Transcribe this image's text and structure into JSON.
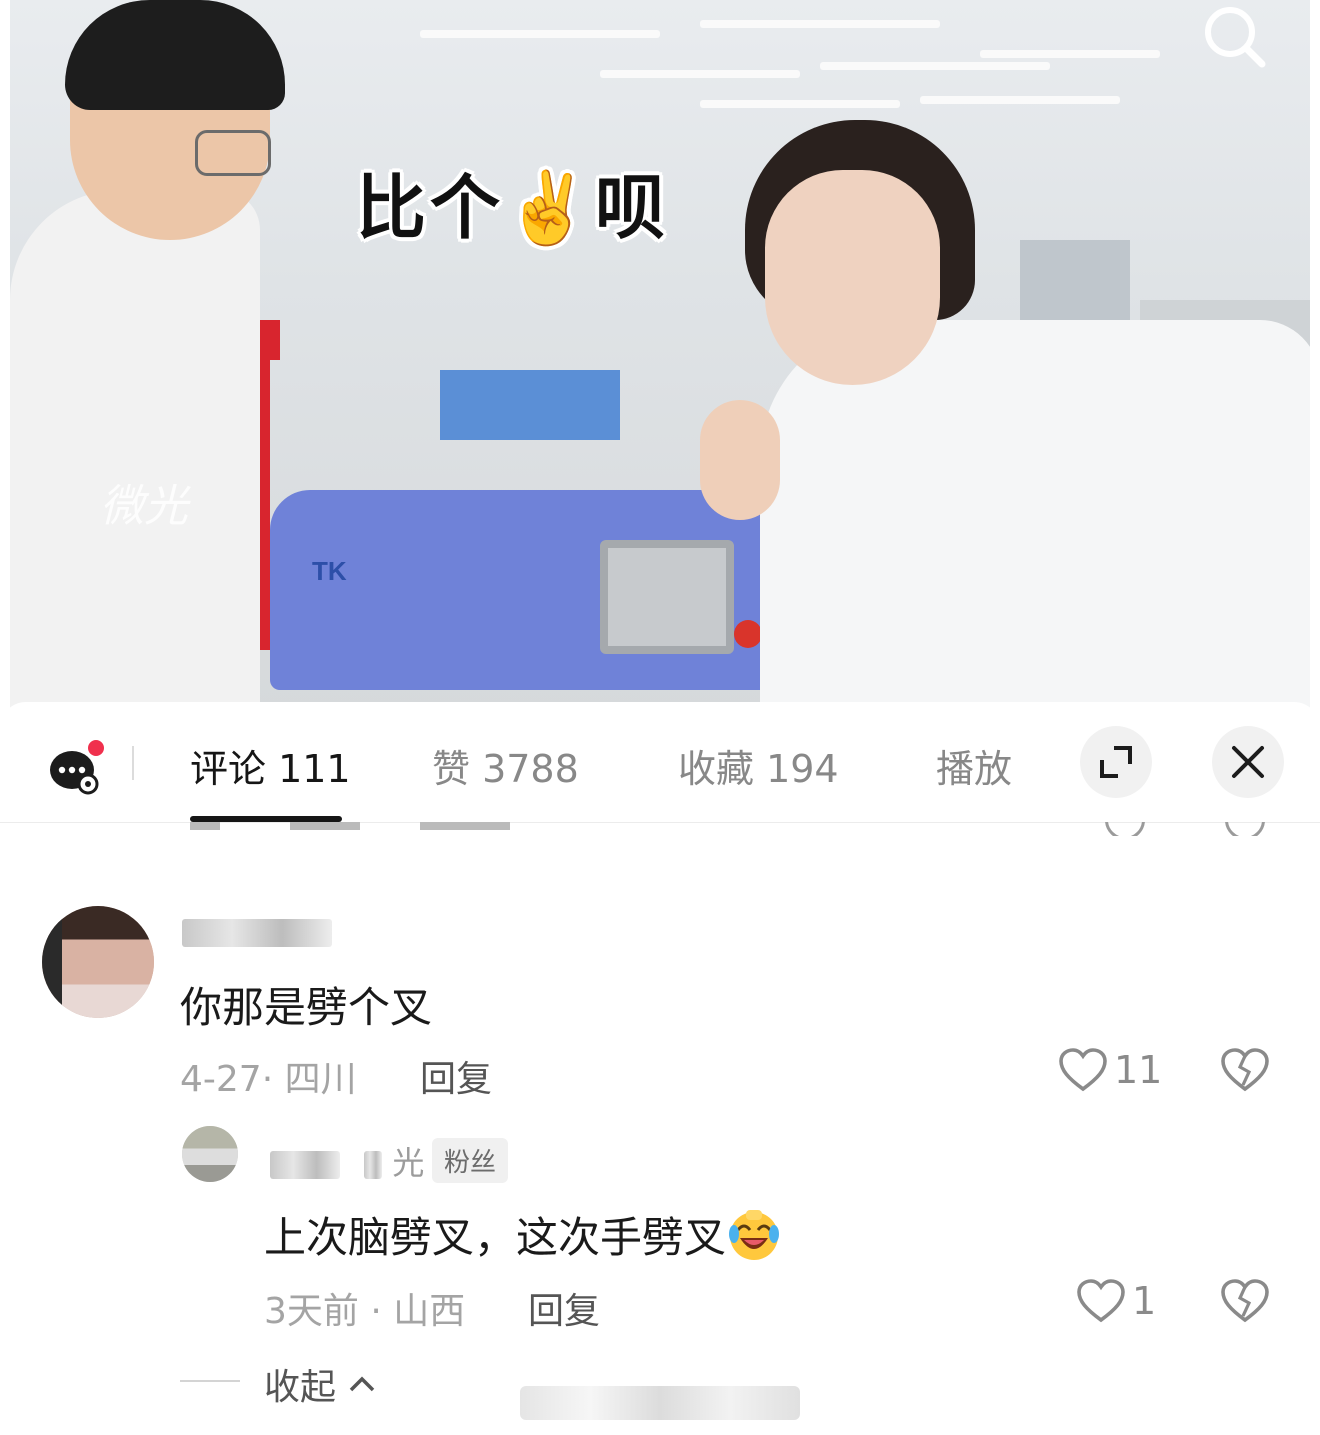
{
  "video": {
    "overlay_caption": "比个✌️呗",
    "watermark": "微光"
  },
  "tabs": [
    {
      "label": "评论 111",
      "active": true
    },
    {
      "label": "赞 3788",
      "active": false
    },
    {
      "label": "收藏 194",
      "active": false
    },
    {
      "label": "播放",
      "active": false
    }
  ],
  "icons": {
    "chat": "chat-bubble-icon",
    "search": "search-icon",
    "expand": "expand-icon",
    "close": "close-icon",
    "like": "heart-icon",
    "dislike": "broken-heart-icon"
  },
  "comments": [
    {
      "text": "你那是劈个叉",
      "date": "4-27",
      "location": "四川",
      "meta": "4-27· 四川",
      "reply_label": "回复",
      "likes": "11",
      "replies": [
        {
          "username_visible": "光",
          "badge": "粉丝",
          "text": "上次脑劈叉，这次手劈叉",
          "meta": "3天前 · 山西",
          "reply_label": "回复",
          "likes": "1"
        }
      ]
    }
  ],
  "collapse_label": "收起",
  "colors": {
    "text_primary": "#1a1a1a",
    "text_muted": "#a4a4a4",
    "notification_dot": "#f0304d",
    "machine_blue": "#6f82d8"
  }
}
